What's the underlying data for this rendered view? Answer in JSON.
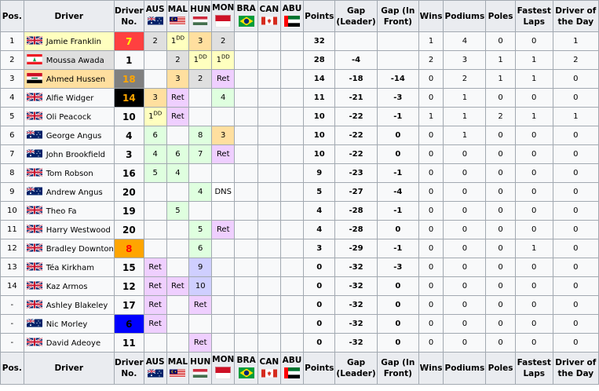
{
  "colors": {
    "win": "#ffffbf",
    "second": "#dfdfdf",
    "third": "#ffdf9f",
    "points": "#dfffdf",
    "finish": "#cfcfff",
    "ret": "#efcfff",
    "dns": "#ffffff",
    "header": "#eaecf0",
    "cell": "#f8f9fa"
  },
  "headers": {
    "pos": "Pos.",
    "driver": "Driver",
    "no": "Driver No.",
    "races": [
      "AUS",
      "MAL",
      "HUN",
      "MON",
      "BRA",
      "CAN",
      "ABU"
    ],
    "points": "Points",
    "gap_leader": "Gap (Leader)",
    "gap_front": "Gap (In Front)",
    "wins": "Wins",
    "podiums": "Podiums",
    "poles": "Poles",
    "fastest": "Fastest Laps",
    "dotd": "Driver of the Day"
  },
  "race_flags": [
    "australia-flag",
    "malaysia-flag",
    "hungary-flag",
    "monaco-flag",
    "brazil-flag",
    "canada-flag",
    "uae-flag"
  ],
  "rows": [
    {
      "pos": "1",
      "flag": "gb-flag",
      "name": "Jamie Franklin",
      "name_bg": "#ffffbf",
      "no": "7",
      "no_bg": "#ff4040",
      "no_fg": "#ffff00",
      "races": [
        {
          "t": "2",
          "c": "second"
        },
        {
          "t": "1",
          "sup": "DD",
          "c": "win"
        },
        {
          "t": "3",
          "c": "third"
        },
        {
          "t": "2",
          "c": "second"
        },
        {
          "t": "",
          "c": ""
        },
        {
          "t": "",
          "c": ""
        },
        {
          "t": "",
          "c": ""
        }
      ],
      "points": "32",
      "gl": "",
      "gf": "",
      "wins": "1",
      "podiums": "4",
      "poles": "0",
      "fl": "0",
      "dotd": "1"
    },
    {
      "pos": "2",
      "flag": "lebanon-flag",
      "name": "Moussa Awada",
      "name_bg": "#dfdfdf",
      "no": "1",
      "no_bg": "",
      "no_fg": "",
      "races": [
        {
          "t": "",
          "c": ""
        },
        {
          "t": "2",
          "c": "second"
        },
        {
          "t": "1",
          "sup": "DD",
          "c": "win"
        },
        {
          "t": "1",
          "sup": "DD",
          "c": "win"
        },
        {
          "t": "",
          "c": ""
        },
        {
          "t": "",
          "c": ""
        },
        {
          "t": "",
          "c": ""
        }
      ],
      "points": "28",
      "gl": "-4",
      "gf": "",
      "wins": "2",
      "podiums": "3",
      "poles": "1",
      "fl": "1",
      "dotd": "2"
    },
    {
      "pos": "3",
      "flag": "iraq-flag",
      "name": "Ahmed Hussen",
      "name_bg": "#ffdf9f",
      "no": "18",
      "no_bg": "#808080",
      "no_fg": "#ffa500",
      "races": [
        {
          "t": "",
          "c": ""
        },
        {
          "t": "3",
          "c": "third"
        },
        {
          "t": "2",
          "c": "second"
        },
        {
          "t": "Ret",
          "c": "ret"
        },
        {
          "t": "",
          "c": ""
        },
        {
          "t": "",
          "c": ""
        },
        {
          "t": "",
          "c": ""
        }
      ],
      "points": "14",
      "gl": "-18",
      "gf": "-14",
      "wins": "0",
      "podiums": "2",
      "poles": "1",
      "fl": "1",
      "dotd": "0"
    },
    {
      "pos": "4",
      "flag": "gb-flag",
      "name": "Alfie Widger",
      "name_bg": "",
      "no": "14",
      "no_bg": "#000000",
      "no_fg": "#ffa500",
      "races": [
        {
          "t": "3",
          "c": "third"
        },
        {
          "t": "Ret",
          "c": "ret"
        },
        {
          "t": "",
          "c": ""
        },
        {
          "t": "4",
          "c": "points"
        },
        {
          "t": "",
          "c": ""
        },
        {
          "t": "",
          "c": ""
        },
        {
          "t": "",
          "c": ""
        }
      ],
      "points": "11",
      "gl": "-21",
      "gf": "-3",
      "wins": "0",
      "podiums": "1",
      "poles": "0",
      "fl": "0",
      "dotd": "0"
    },
    {
      "pos": "5",
      "flag": "gb-flag",
      "name": "Oli Peacock",
      "name_bg": "",
      "no": "10",
      "no_bg": "",
      "no_fg": "",
      "races": [
        {
          "t": "1",
          "sup": "DD",
          "c": "win"
        },
        {
          "t": "Ret",
          "c": "ret"
        },
        {
          "t": "",
          "c": ""
        },
        {
          "t": "",
          "c": ""
        },
        {
          "t": "",
          "c": ""
        },
        {
          "t": "",
          "c": ""
        },
        {
          "t": "",
          "c": ""
        }
      ],
      "points": "10",
      "gl": "-22",
      "gf": "-1",
      "wins": "1",
      "podiums": "1",
      "poles": "2",
      "fl": "1",
      "dotd": "1"
    },
    {
      "pos": "6",
      "flag": "australia-flag",
      "name": "George Angus",
      "name_bg": "",
      "no": "4",
      "no_bg": "",
      "no_fg": "",
      "races": [
        {
          "t": "6",
          "c": "points"
        },
        {
          "t": "",
          "c": ""
        },
        {
          "t": "8",
          "c": "points"
        },
        {
          "t": "3",
          "c": "third"
        },
        {
          "t": "",
          "c": ""
        },
        {
          "t": "",
          "c": ""
        },
        {
          "t": "",
          "c": ""
        }
      ],
      "points": "10",
      "gl": "-22",
      "gf": "0",
      "wins": "0",
      "podiums": "1",
      "poles": "0",
      "fl": "0",
      "dotd": "0"
    },
    {
      "pos": "7",
      "flag": "australia-flag",
      "name": "John Brookfield",
      "name_bg": "",
      "no": "3",
      "no_bg": "",
      "no_fg": "",
      "races": [
        {
          "t": "4",
          "c": "points"
        },
        {
          "t": "6",
          "c": "points"
        },
        {
          "t": "7",
          "c": "points"
        },
        {
          "t": "Ret",
          "c": "ret"
        },
        {
          "t": "",
          "c": ""
        },
        {
          "t": "",
          "c": ""
        },
        {
          "t": "",
          "c": ""
        }
      ],
      "points": "10",
      "gl": "-22",
      "gf": "0",
      "wins": "0",
      "podiums": "0",
      "poles": "0",
      "fl": "0",
      "dotd": "0"
    },
    {
      "pos": "8",
      "flag": "gb-flag",
      "name": "Tom Robson",
      "name_bg": "",
      "no": "16",
      "no_bg": "",
      "no_fg": "",
      "races": [
        {
          "t": "5",
          "c": "points"
        },
        {
          "t": "4",
          "c": "points"
        },
        {
          "t": "",
          "c": ""
        },
        {
          "t": "",
          "c": ""
        },
        {
          "t": "",
          "c": ""
        },
        {
          "t": "",
          "c": ""
        },
        {
          "t": "",
          "c": ""
        }
      ],
      "points": "9",
      "gl": "-23",
      "gf": "-1",
      "wins": "0",
      "podiums": "0",
      "poles": "0",
      "fl": "0",
      "dotd": "0"
    },
    {
      "pos": "9",
      "flag": "australia-flag",
      "name": "Andrew Angus",
      "name_bg": "",
      "no": "20",
      "no_bg": "",
      "no_fg": "",
      "races": [
        {
          "t": "",
          "c": ""
        },
        {
          "t": "",
          "c": ""
        },
        {
          "t": "4",
          "c": "points"
        },
        {
          "t": "DNS",
          "c": "dns"
        },
        {
          "t": "",
          "c": ""
        },
        {
          "t": "",
          "c": ""
        },
        {
          "t": "",
          "c": ""
        }
      ],
      "points": "5",
      "gl": "-27",
      "gf": "-4",
      "wins": "0",
      "podiums": "0",
      "poles": "0",
      "fl": "0",
      "dotd": "0"
    },
    {
      "pos": "10",
      "flag": "gb-flag",
      "name": "Theo Fa",
      "name_bg": "",
      "no": "19",
      "no_bg": "",
      "no_fg": "",
      "races": [
        {
          "t": "",
          "c": ""
        },
        {
          "t": "5",
          "c": "points"
        },
        {
          "t": "",
          "c": ""
        },
        {
          "t": "",
          "c": ""
        },
        {
          "t": "",
          "c": ""
        },
        {
          "t": "",
          "c": ""
        },
        {
          "t": "",
          "c": ""
        }
      ],
      "points": "4",
      "gl": "-28",
      "gf": "-1",
      "wins": "0",
      "podiums": "0",
      "poles": "0",
      "fl": "0",
      "dotd": "0"
    },
    {
      "pos": "11",
      "flag": "gb-flag",
      "name": "Harry Westwood",
      "name_bg": "",
      "no": "20",
      "no_bg": "",
      "no_fg": "",
      "races": [
        {
          "t": "",
          "c": ""
        },
        {
          "t": "",
          "c": ""
        },
        {
          "t": "5",
          "c": "points"
        },
        {
          "t": "Ret",
          "c": "ret"
        },
        {
          "t": "",
          "c": ""
        },
        {
          "t": "",
          "c": ""
        },
        {
          "t": "",
          "c": ""
        }
      ],
      "points": "4",
      "gl": "-28",
      "gf": "0",
      "wins": "0",
      "podiums": "0",
      "poles": "0",
      "fl": "0",
      "dotd": "0"
    },
    {
      "pos": "12",
      "flag": "gb-flag",
      "name": "Bradley Downton",
      "name_bg": "",
      "no": "8",
      "no_bg": "#ffa500",
      "no_fg": "#ff0000",
      "races": [
        {
          "t": "",
          "c": ""
        },
        {
          "t": "",
          "c": ""
        },
        {
          "t": "6",
          "c": "points"
        },
        {
          "t": "",
          "c": ""
        },
        {
          "t": "",
          "c": ""
        },
        {
          "t": "",
          "c": ""
        },
        {
          "t": "",
          "c": ""
        }
      ],
      "points": "3",
      "gl": "-29",
      "gf": "-1",
      "wins": "0",
      "podiums": "0",
      "poles": "0",
      "fl": "1",
      "dotd": "0"
    },
    {
      "pos": "13",
      "flag": "gb-flag",
      "name": "Téa Kirkham",
      "name_bg": "",
      "no": "15",
      "no_bg": "",
      "no_fg": "",
      "races": [
        {
          "t": "Ret",
          "c": "ret"
        },
        {
          "t": "",
          "c": ""
        },
        {
          "t": "9",
          "c": "finish"
        },
        {
          "t": "",
          "c": ""
        },
        {
          "t": "",
          "c": ""
        },
        {
          "t": "",
          "c": ""
        },
        {
          "t": "",
          "c": ""
        }
      ],
      "points": "0",
      "gl": "-32",
      "gf": "-3",
      "wins": "0",
      "podiums": "0",
      "poles": "0",
      "fl": "0",
      "dotd": "0"
    },
    {
      "pos": "14",
      "flag": "gb-flag",
      "name": "Kaz Armos",
      "name_bg": "",
      "no": "12",
      "no_bg": "",
      "no_fg": "",
      "races": [
        {
          "t": "Ret",
          "c": "ret"
        },
        {
          "t": "Ret",
          "c": "ret"
        },
        {
          "t": "10",
          "c": "finish"
        },
        {
          "t": "",
          "c": ""
        },
        {
          "t": "",
          "c": ""
        },
        {
          "t": "",
          "c": ""
        },
        {
          "t": "",
          "c": ""
        }
      ],
      "points": "0",
      "gl": "-32",
      "gf": "0",
      "wins": "0",
      "podiums": "0",
      "poles": "0",
      "fl": "0",
      "dotd": "0"
    },
    {
      "pos": "-",
      "flag": "gb-flag",
      "name": "Ashley Blakeley",
      "name_bg": "",
      "no": "17",
      "no_bg": "",
      "no_fg": "",
      "races": [
        {
          "t": "Ret",
          "c": "ret"
        },
        {
          "t": "",
          "c": ""
        },
        {
          "t": "Ret",
          "c": "ret"
        },
        {
          "t": "",
          "c": ""
        },
        {
          "t": "",
          "c": ""
        },
        {
          "t": "",
          "c": ""
        },
        {
          "t": "",
          "c": ""
        }
      ],
      "points": "0",
      "gl": "-32",
      "gf": "0",
      "wins": "0",
      "podiums": "0",
      "poles": "0",
      "fl": "0",
      "dotd": "0"
    },
    {
      "pos": "-",
      "flag": "australia-flag",
      "name": "Nic Morley",
      "name_bg": "",
      "no": "6",
      "no_bg": "#0000ff",
      "no_fg": "#000000",
      "races": [
        {
          "t": "Ret",
          "c": "ret"
        },
        {
          "t": "",
          "c": ""
        },
        {
          "t": "",
          "c": ""
        },
        {
          "t": "",
          "c": ""
        },
        {
          "t": "",
          "c": ""
        },
        {
          "t": "",
          "c": ""
        },
        {
          "t": "",
          "c": ""
        }
      ],
      "points": "0",
      "gl": "-32",
      "gf": "0",
      "wins": "0",
      "podiums": "0",
      "poles": "0",
      "fl": "0",
      "dotd": "0"
    },
    {
      "pos": "-",
      "flag": "gb-flag",
      "name": "David Adeoye",
      "name_bg": "",
      "no": "11",
      "no_bg": "",
      "no_fg": "",
      "races": [
        {
          "t": "",
          "c": ""
        },
        {
          "t": "",
          "c": ""
        },
        {
          "t": "Ret",
          "c": "ret"
        },
        {
          "t": "",
          "c": ""
        },
        {
          "t": "",
          "c": ""
        },
        {
          "t": "",
          "c": ""
        },
        {
          "t": "",
          "c": ""
        }
      ],
      "points": "0",
      "gl": "-32",
      "gf": "0",
      "wins": "0",
      "podiums": "0",
      "poles": "0",
      "fl": "0",
      "dotd": "0"
    }
  ]
}
